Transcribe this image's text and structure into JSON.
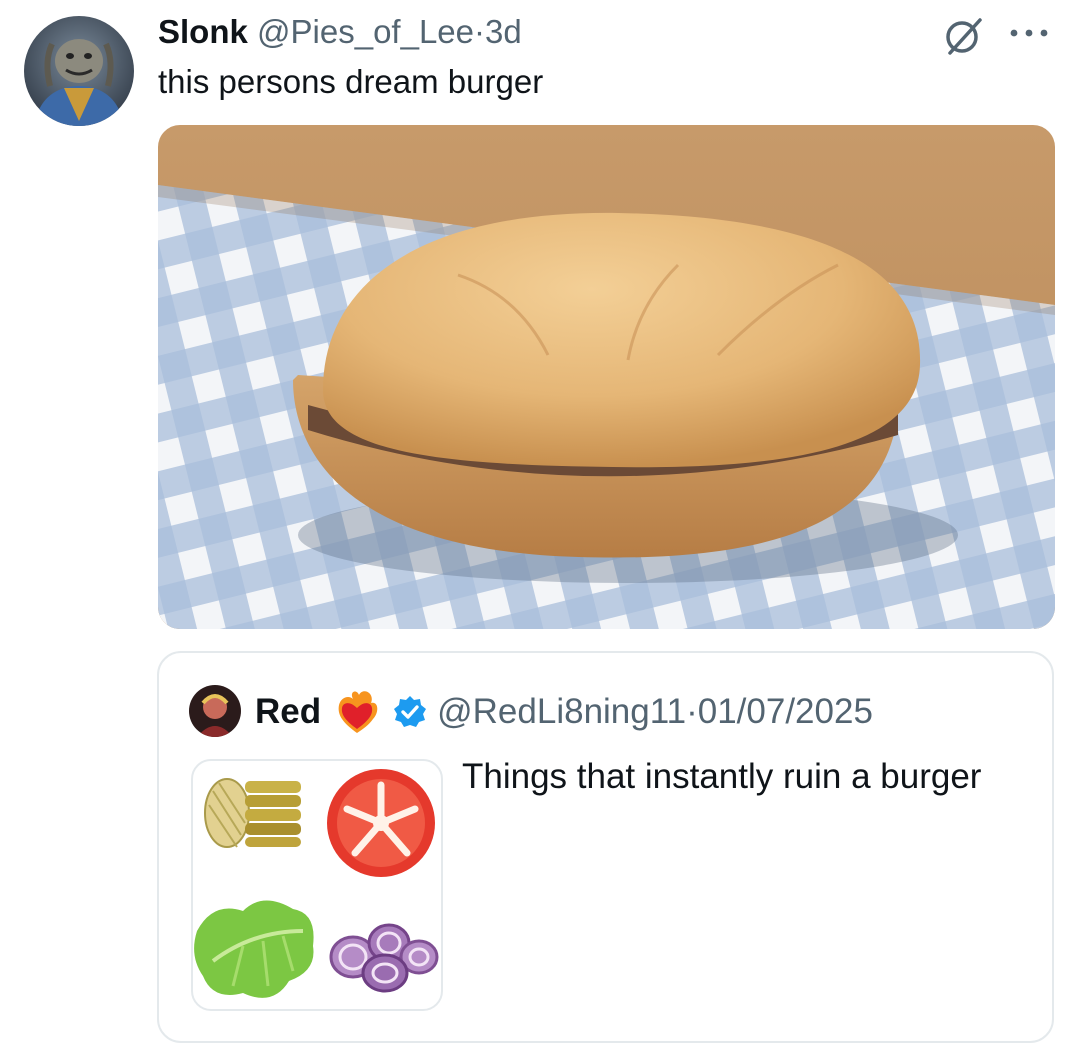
{
  "tweet": {
    "author_name": "Slonk",
    "author_handle": "@Pies_of_Lee",
    "separator": "·",
    "age": "3d",
    "text": "this persons dream burger",
    "avatar": "alien-character-avatar",
    "media": "plain-burger-photo"
  },
  "quoted_tweet": {
    "author_name": "Red",
    "author_emoji": "heart-on-fire-emoji",
    "verified": true,
    "author_handle": "@RedLi8ning11",
    "separator": "·",
    "date": "01/07/2025",
    "text": "Things that instantly ruin a burger",
    "media_grid": [
      "pickles",
      "tomato-slice",
      "lettuce",
      "red-onion-slices"
    ]
  },
  "icons": {
    "grok": "grok-icon",
    "more": "more-options-icon"
  },
  "colors": {
    "text_primary": "#0f1419",
    "text_secondary": "#536471",
    "verified_blue": "#1d9bf0",
    "border": "#e4e9ec"
  }
}
